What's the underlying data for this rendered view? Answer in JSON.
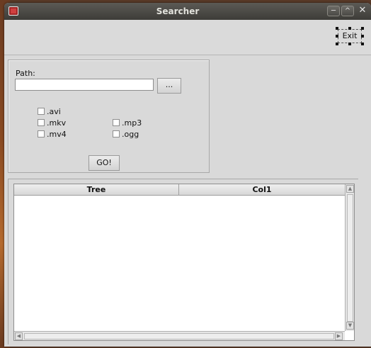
{
  "window": {
    "title": "Searcher",
    "minimize_glyph": "─",
    "maximize_glyph": "^",
    "close_glyph": "✕"
  },
  "toolbar": {
    "exit_label": "Exit"
  },
  "search": {
    "path_label": "Path:",
    "path_value": "",
    "browse_label": "...",
    "go_label": "GO!"
  },
  "extensions": [
    {
      "label": ".avi",
      "checked": false
    },
    {
      "label": ".mkv",
      "checked": false
    },
    {
      "label": ".mv4",
      "checked": false
    },
    {
      "label": ".mp3",
      "checked": false
    },
    {
      "label": ".ogg",
      "checked": false
    }
  ],
  "tree": {
    "columns": [
      "Tree",
      "Col1"
    ],
    "rows": []
  },
  "icons": {
    "app": "app-window-icon",
    "scroll_up": "arrow-up-icon",
    "scroll_down": "arrow-down-icon",
    "scroll_left": "arrow-left-icon",
    "scroll_right": "arrow-right-icon"
  },
  "colors": {
    "titlebar": "#3d3c38",
    "window_bg": "#d9d9d9",
    "app_icon": "#a02525"
  }
}
